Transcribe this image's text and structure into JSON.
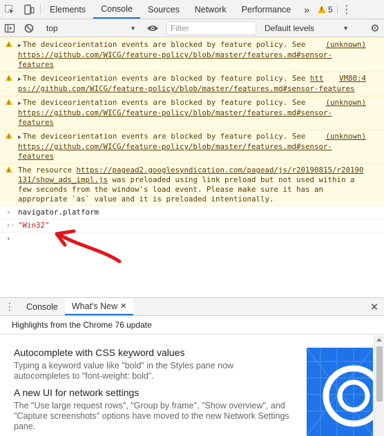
{
  "tabs": {
    "items": [
      {
        "label": "Elements"
      },
      {
        "label": "Console"
      },
      {
        "label": "Sources"
      },
      {
        "label": "Network"
      },
      {
        "label": "Performance"
      }
    ],
    "more": "»",
    "warning_count": "5",
    "menu": "⋮"
  },
  "toolbar": {
    "context": "top",
    "filter_placeholder": "Filter",
    "levels": "Default levels"
  },
  "console": {
    "messages": [
      {
        "text": "The deviceorientation events are blocked by feature policy. See ",
        "source": "(unknown)",
        "link": "https://github.com/WICG/feature-policy/blob/master/features.md#sensor-features"
      },
      {
        "text": "The deviceorientation events are blocked by feature policy. See ",
        "source": "VM80:4",
        "link_a": "htt",
        "link_b": "ps://github.com/WICG/feature-policy/blob/master/features.md#sensor-features"
      },
      {
        "text": "The deviceorientation events are blocked by feature policy. See ",
        "source": "(unknown)",
        "link": "https://github.com/WICG/feature-policy/blob/master/features.md#sensor-features"
      },
      {
        "text": "The deviceorientation events are blocked by feature policy. See ",
        "source": "(unknown)",
        "link": "https://github.com/WICG/feature-policy/blob/master/features.md#sensor-features"
      }
    ],
    "preload": {
      "prefix": "The resource ",
      "link": "https://pagead2.googlesyndication.com/pagead/js/r20190815/r20190131/show_ads_impl.js",
      "suffix": " was preloaded using link preload but not used within a few seconds from the window's load event. Please make sure it has an appropriate `as` value and it is preloaded intentionally."
    },
    "input": "navigator.platform",
    "result": "\"Win32\""
  },
  "drawer": {
    "tabs": [
      {
        "label": "Console"
      },
      {
        "label": "What's New"
      }
    ],
    "close_tab": "✕",
    "close_drawer": "✕",
    "highlights": "Highlights from the Chrome 76 update",
    "features": [
      {
        "title": "Autocomplete with CSS keyword values",
        "desc": "Typing a keyword value like \"bold\" in the Styles pane now autocompletes to \"font-weight: bold\"."
      },
      {
        "title": "A new UI for network settings",
        "desc": "The \"Use large request rows\", \"Group by frame\", \"Show overview\", and \"Capture screenshots\" options have moved to the new Network Settings pane."
      }
    ]
  },
  "colors": {
    "accent": "#1a73e8",
    "warning_bg": "#fffbe5",
    "warning_text": "#5c3c00",
    "result_text": "#c41a16",
    "annotation": "#e2151b"
  },
  "icons": [
    "inspect-element-icon",
    "device-toolbar-icon",
    "warning-icon",
    "sidebar-toggle-icon",
    "clear-console-icon",
    "eye-icon",
    "gear-icon",
    "input-chevron-icon",
    "output-arrow-icon",
    "prompt-icon",
    "drawer-menu-icon",
    "close-icon"
  ]
}
